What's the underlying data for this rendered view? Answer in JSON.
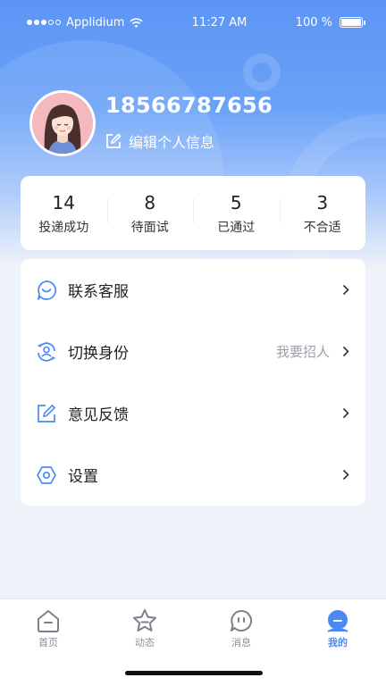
{
  "status_bar": {
    "carrier": "Applidium",
    "time": "11:27 AM",
    "battery": "100 %"
  },
  "profile": {
    "phone": "18566787656",
    "edit_label": "编辑个人信息"
  },
  "stats": [
    {
      "value": "14",
      "label": "投递成功"
    },
    {
      "value": "8",
      "label": "待面试"
    },
    {
      "value": "5",
      "label": "已通过"
    },
    {
      "value": "3",
      "label": "不合适"
    }
  ],
  "menu": [
    {
      "label": "联系客服",
      "sub": "",
      "icon": "headset-smile-icon"
    },
    {
      "label": "切换身份",
      "sub": "我要招人",
      "icon": "switch-user-icon"
    },
    {
      "label": "意见反馈",
      "sub": "",
      "icon": "edit-feedback-icon"
    },
    {
      "label": "设置",
      "sub": "",
      "icon": "hexagon-settings-icon"
    }
  ],
  "tabs": [
    {
      "label": "首页",
      "icon": "home-icon",
      "active": false
    },
    {
      "label": "动态",
      "icon": "star-icon",
      "active": false
    },
    {
      "label": "消息",
      "icon": "message-icon",
      "active": false
    },
    {
      "label": "我的",
      "icon": "profile-icon",
      "active": true
    }
  ],
  "colors": {
    "accent": "#4a8af4",
    "hero_top": "#5c95f5",
    "background": "#eef2f9"
  }
}
